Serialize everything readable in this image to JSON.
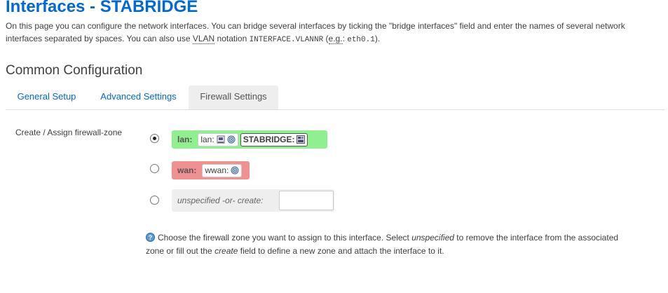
{
  "header": {
    "title": "Interfaces - STABRIDGE",
    "intro_1": "On this page you can configure the network interfaces. You can bridge several interfaces by ticking the \"bridge interfaces\" field and enter the names of several network interfaces separated by spaces. You can also use ",
    "vlan_abbr": "VLAN",
    "intro_2": " notation ",
    "vlan_code": "INTERFACE.VLANNR",
    "intro_3": " (",
    "eg_abbr": "e.g.",
    "intro_4": ": ",
    "eg_code": "eth0.1",
    "intro_5": ")."
  },
  "section": {
    "title": "Common Configuration"
  },
  "tabs": [
    {
      "label": "General Setup",
      "active": false
    },
    {
      "label": "Advanced Settings",
      "active": false
    },
    {
      "label": "Firewall Settings",
      "active": true
    }
  ],
  "field": {
    "label": "Create / Assign firewall-zone",
    "options": [
      {
        "selected": true,
        "zone": "lan:",
        "color": "#90f090",
        "networks": [
          {
            "label": "lan:",
            "icons": [
              "ethernet-port-icon",
              "wireless-icon"
            ]
          },
          {
            "label": "STABRIDGE:",
            "icons": [
              "bridge-icon"
            ],
            "bold": true
          }
        ]
      },
      {
        "selected": false,
        "zone": "wan:",
        "color": "#f09090",
        "networks": [
          {
            "label": "wwan:",
            "icons": [
              "wireless-icon"
            ]
          }
        ]
      },
      {
        "selected": false,
        "create_label": "unspecified -or- create:",
        "create_value": ""
      }
    ]
  },
  "help": {
    "text_1": "Choose the firewall zone you want to assign to this interface. Select ",
    "em_1": "unspecified",
    "text_2": " to remove the interface from the associated zone or fill out the ",
    "em_2": "create",
    "text_3": " field to define a new zone and attach the interface to it."
  }
}
